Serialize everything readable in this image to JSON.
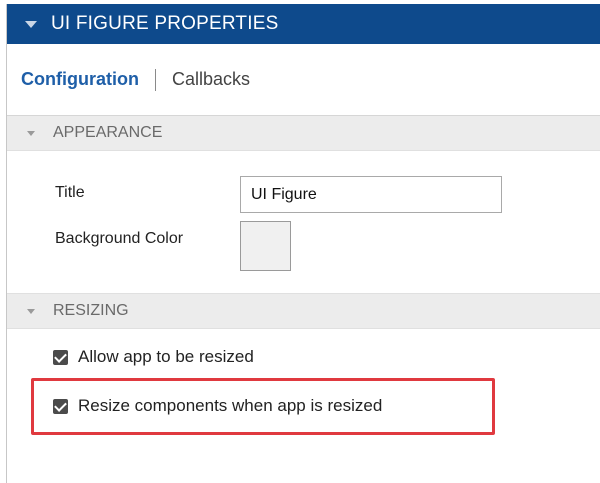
{
  "header": {
    "title": "UI FIGURE PROPERTIES"
  },
  "tabs": [
    {
      "label": "Configuration"
    },
    {
      "label": "Callbacks"
    }
  ],
  "appearance": {
    "heading": "APPEARANCE",
    "title_label": "Title",
    "title_value": "UI Figure",
    "bg_color_label": "Background Color",
    "bg_color_value": "#f0f0f0"
  },
  "resizing": {
    "heading": "RESIZING",
    "allow_resize_label": "Allow app to be resized",
    "allow_resize_checked": true,
    "resize_components_label": "Resize components when app is resized",
    "resize_components_checked": true
  },
  "colors": {
    "header_bg": "#0e4a8c",
    "active_tab": "#1f5fa8",
    "highlight_border": "#e0393f"
  }
}
